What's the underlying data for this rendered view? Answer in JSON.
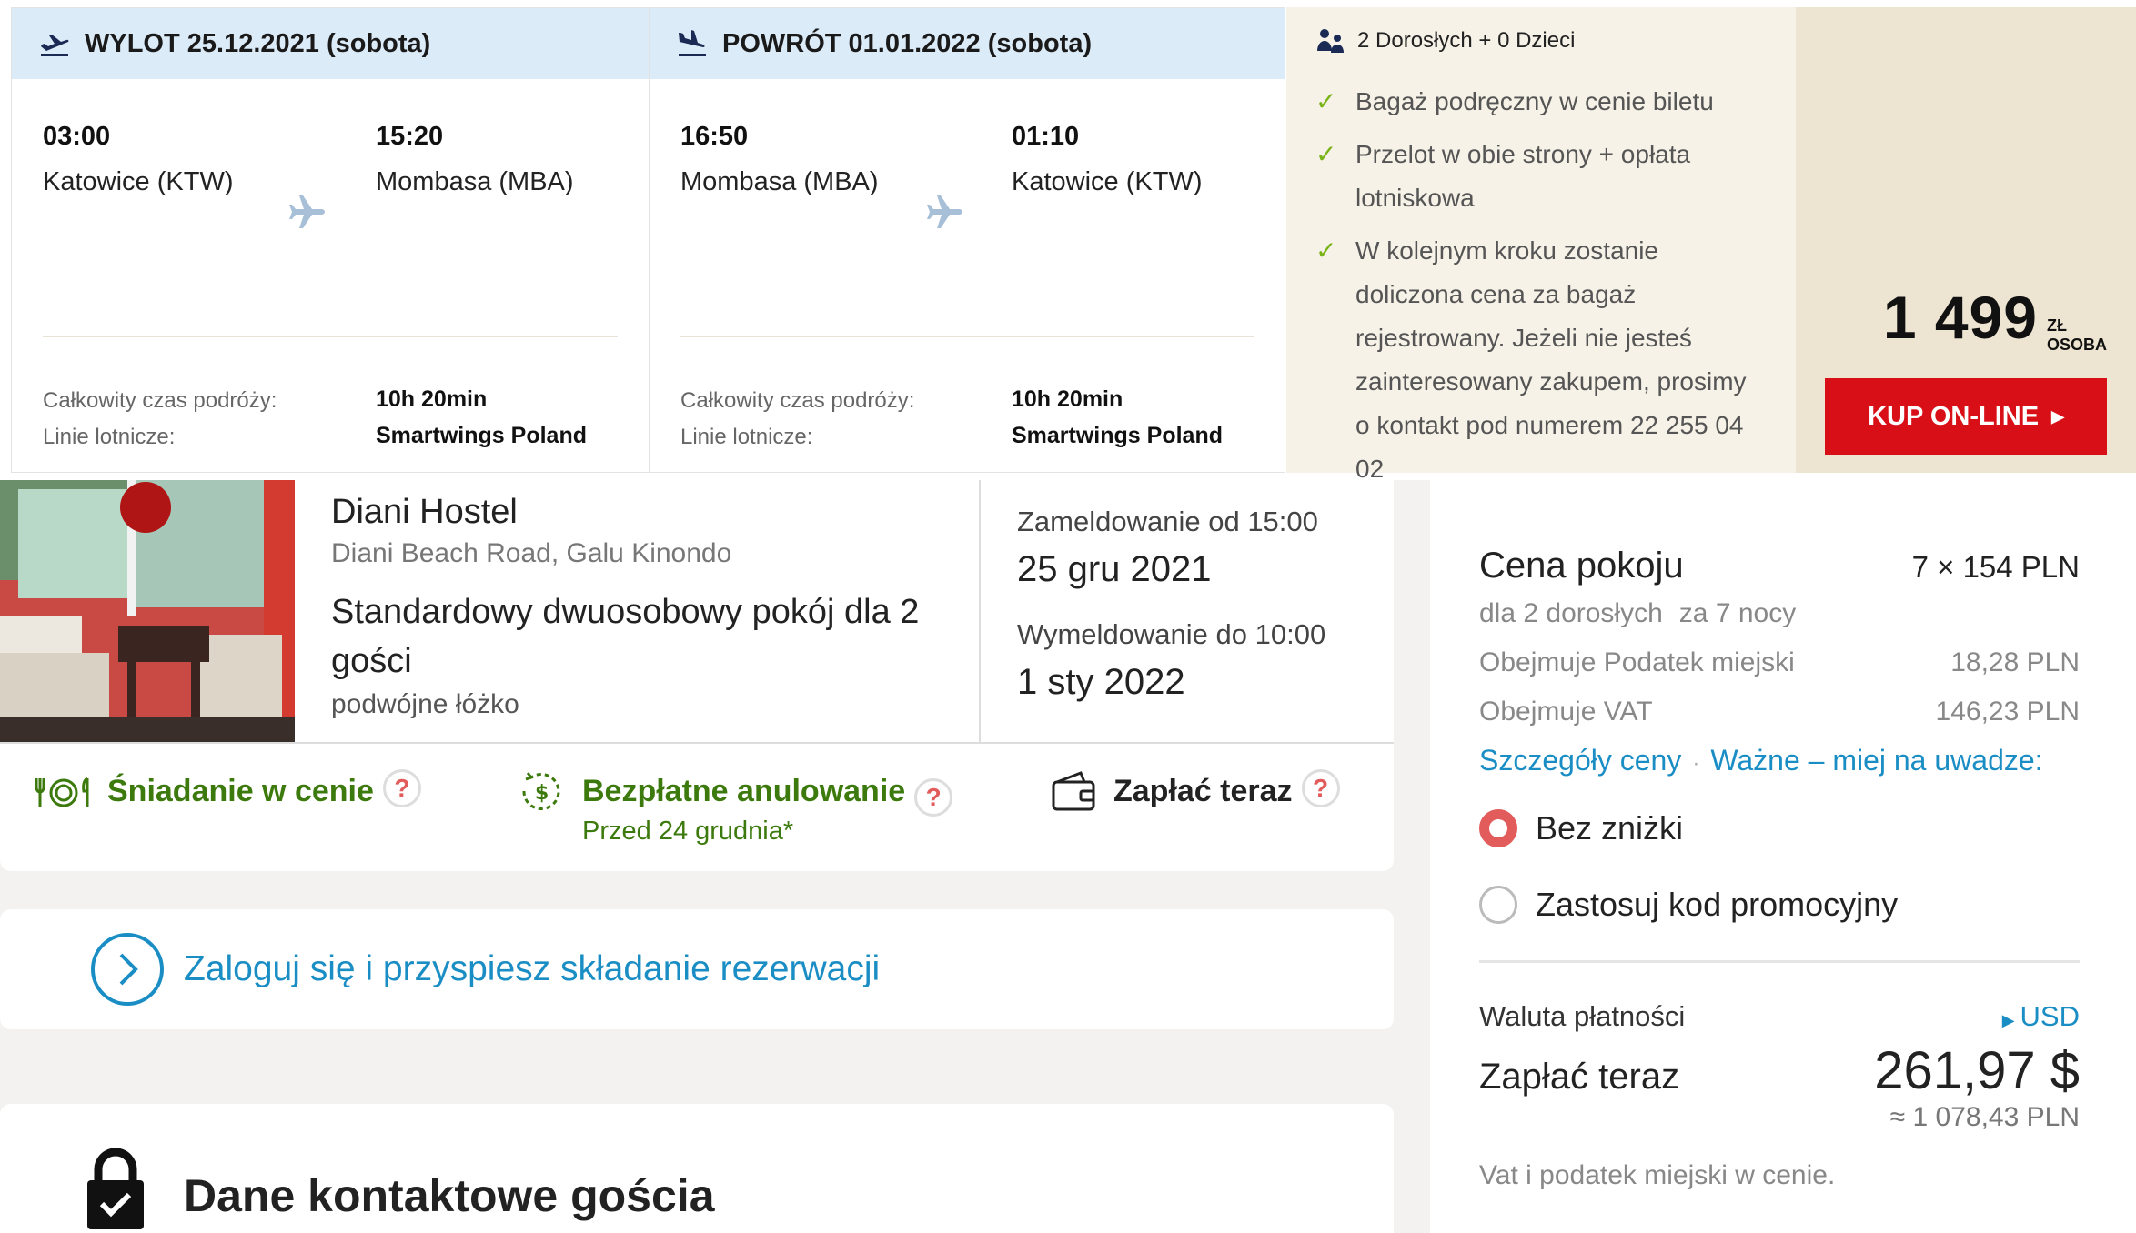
{
  "flight": {
    "outbound": {
      "header": "WYLOT 25.12.2021 (sobota)",
      "dep_time": "03:00",
      "dep_city": "Katowice (KTW)",
      "arr_time": "15:20",
      "arr_city": "Mombasa (MBA)",
      "duration_label": "Całkowity czas podróży:",
      "duration": "10h 20min",
      "airline_label": "Linie lotnicze:",
      "airline": "Smartwings Poland"
    },
    "return": {
      "header": "POWRÓT 01.01.2022 (sobota)",
      "dep_time": "16:50",
      "dep_city": "Mombasa (MBA)",
      "arr_time": "01:10",
      "arr_city": "Katowice (KTW)",
      "duration_label": "Całkowity czas podróży:",
      "duration": "10h 20min",
      "airline_label": "Linie lotnicze:",
      "airline": "Smartwings Poland"
    },
    "passengers": "2 Dorosłych + 0 Dzieci",
    "features": [
      "Bagaż podręczny w cenie biletu",
      "Przelot w obie strony + opłata lotniskowa",
      "W kolejnym kroku zostanie doliczona cena za bagaż rejestrowany. Jeżeli nie jesteś zainteresowany zakupem, prosimy o kontakt pod numerem 22 255 04 02"
    ],
    "price": "1 499",
    "price_unit": "ZŁ",
    "price_per": "OSOBA",
    "buy_label": "KUP ON-LINE",
    "accent_color": "#d80f16"
  },
  "hotel": {
    "name": "Diani Hostel",
    "address": "Diani Beach Road, Galu Kinondo",
    "room": "Standardowy dwuosobowy pokój dla 2 gości",
    "bed": "podwójne łóżko",
    "checkin_label": "Zameldowanie od 15:00",
    "checkin_date": "25 gru 2021",
    "checkout_label": "Wymeldowanie do 10:00",
    "checkout_date": "1 sty 2022",
    "breakfast": "Śniadanie w cenie",
    "cancel": "Bezpłatne anulowanie",
    "cancel_sub": "Przed 24 grudnia*",
    "pay": "Zapłać teraz",
    "help": "?"
  },
  "login": {
    "text": "Zaloguj się i przyspiesz składanie rezerwacji"
  },
  "contact": {
    "title": "Dane kontaktowe gościa"
  },
  "summary": {
    "room_price_label": "Cena pokoju",
    "room_price_value": "7 × 154 PLN",
    "for_guests": "dla 2 dorosłych",
    "for_nights": "za 7 nocy",
    "city_tax_label": "Obejmuje Podatek miejski",
    "city_tax_value": "18,28 PLN",
    "vat_label": "Obejmuje VAT",
    "vat_value": "146,23 PLN",
    "link_details": "Szczegóły ceny",
    "link_important": "Ważne – miej na uwadze:",
    "option_no_discount": "Bez zniżki",
    "option_promo": "Zastosuj kod promocyjny",
    "currency_label": "Waluta płatności",
    "currency_value": "USD",
    "pay_now_label": "Zapłać teraz",
    "pay_now_value": "261,97 $",
    "pay_now_pln": "≈ 1 078,43 PLN",
    "note": "Vat i podatek miejski w cenie.",
    "link_color": "#1a8ec4"
  }
}
